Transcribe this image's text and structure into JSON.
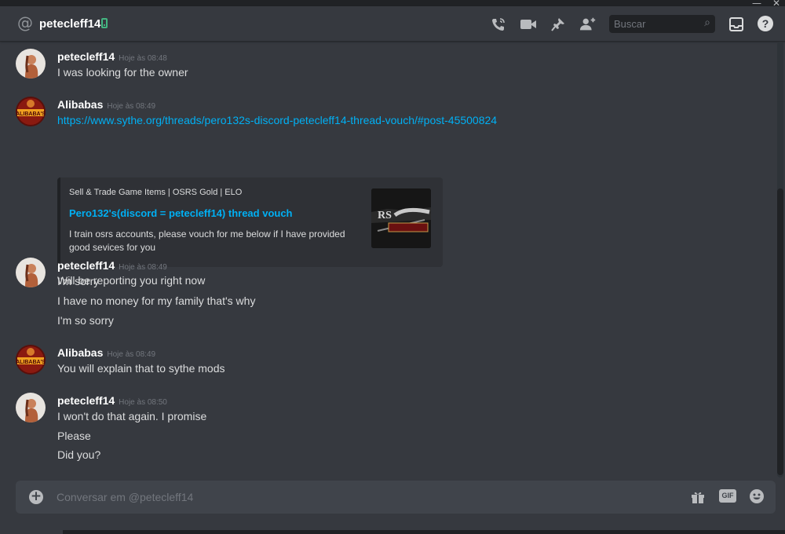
{
  "window": {
    "minimize_glyph": "—",
    "close_glyph": "✕"
  },
  "header": {
    "at_symbol": "@",
    "username": "petecleff14",
    "search_placeholder": "Buscar",
    "help_glyph": "?",
    "icons": [
      "phone-call-icon",
      "video-call-icon",
      "pin-icon",
      "add-friend-icon",
      "search-icon",
      "inbox-icon",
      "help-icon"
    ]
  },
  "messages": [
    {
      "author": "petecleff14",
      "timestamp": "Hoje às 08:48",
      "avatar": "petecleff14-avatar",
      "lines": [
        "I was looking for the owner"
      ]
    },
    {
      "author": "Alibabas",
      "timestamp": "Hoje às 08:49",
      "avatar": "alibabas-avatar",
      "link": "https://www.sythe.org/threads/pero132s-discord-petecleff14-thread-vouch/#post-45500824",
      "embed": {
        "provider": "Sell & Trade Game Items | OSRS Gold | ELO",
        "title": "Pero132's(discord = petecleff14) thread vouch",
        "description": "I train osrs accounts, please vouch for me below if I have provided good sevices for you"
      },
      "after_embed": "Will be reporting you right now"
    },
    {
      "author": "petecleff14",
      "timestamp": "Hoje às 08:49",
      "avatar": "petecleff14-avatar",
      "lines": [
        "I'm sorry",
        "I have no money for my family that's why",
        "I'm so sorry"
      ]
    },
    {
      "author": "Alibabas",
      "timestamp": "Hoje às 08:49",
      "avatar": "alibabas-avatar",
      "lines": [
        "You will explain that to sythe mods"
      ]
    },
    {
      "author": "petecleff14",
      "timestamp": "Hoje às 08:50",
      "avatar": "petecleff14-avatar",
      "lines": [
        "I won't do that again. I promise",
        "Please",
        "Did you?"
      ]
    }
  ],
  "composer": {
    "placeholder": "Conversar em @petecleff14",
    "plus_glyph": "+",
    "gif_label": "GIF",
    "icons": [
      "upload-plus-icon",
      "gift-icon",
      "gif-icon",
      "emoji-icon"
    ]
  },
  "colors": {
    "background": "#36393f",
    "link": "#00b0f4",
    "online": "#43b581",
    "input": "#40444b"
  }
}
